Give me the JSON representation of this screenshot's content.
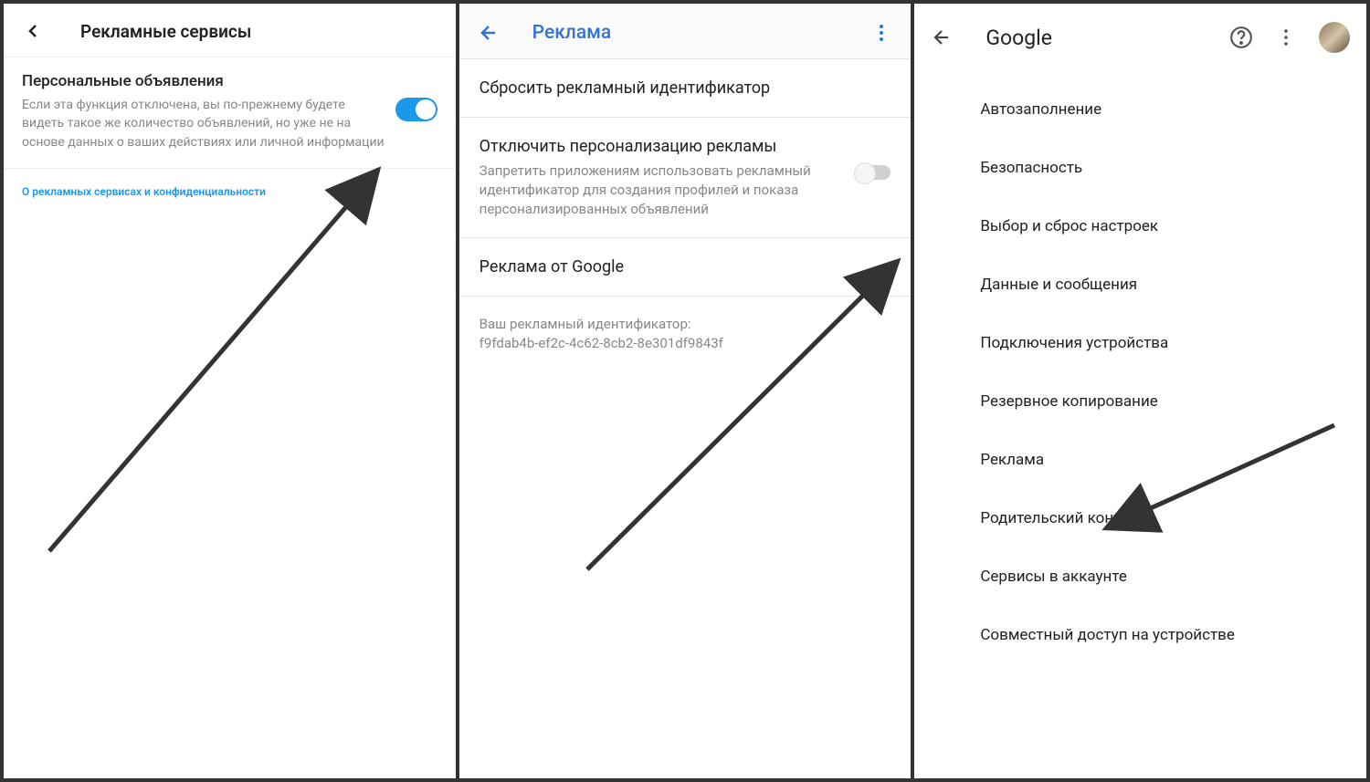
{
  "screen1": {
    "title": "Рекламные сервисы",
    "setting": {
      "title": "Персональные объявления",
      "description": "Если эта функция отключена, вы по-прежнему будете видеть такое же количество объявлений, но уже не на основе данных о ваших действиях или личной информации"
    },
    "link": "О рекламных сервисах и конфиденциальности"
  },
  "screen2": {
    "title": "Реклама",
    "reset": "Сбросить рекламный идентификатор",
    "disable_personalization": {
      "title": "Отключить персонализацию рекламы",
      "description": "Запретить приложениям использовать рекламный идентификатор для создания профилей и показа персонализированных объявлений"
    },
    "google_ads": "Реклама от Google",
    "ad_id_label": "Ваш рекламный идентификатор:",
    "ad_id_value": "f9fdab4b-ef2c-4c62-8cb2-8e301df9843f"
  },
  "screen3": {
    "title": "Google",
    "items": [
      "Автозаполнение",
      "Безопасность",
      "Выбор и сброс настроек",
      "Данные и сообщения",
      "Подключения устройства",
      "Резервное копирование",
      "Реклама",
      "Родительский контроль",
      "Сервисы в аккаунте",
      "Совместный доступ на устройстве"
    ]
  }
}
